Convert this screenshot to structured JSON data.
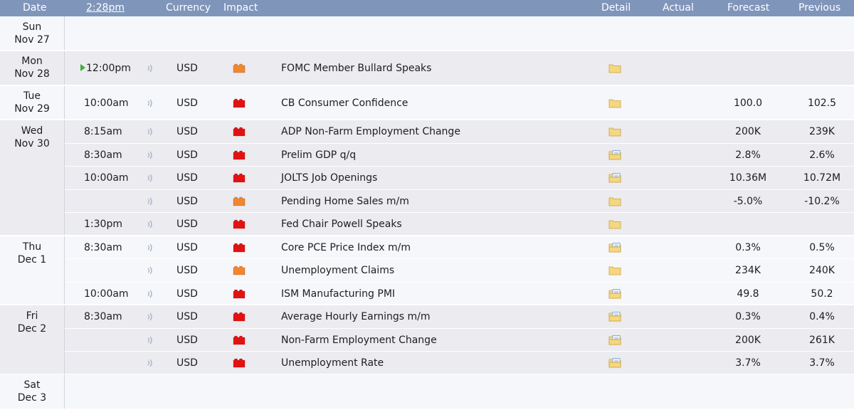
{
  "header": {
    "date": "Date",
    "time": "2:28pm",
    "currency": "Currency",
    "impact": "Impact",
    "detail": "Detail",
    "actual": "Actual",
    "forecast": "Forecast",
    "previous": "Previous"
  },
  "colors": {
    "header_bg": "#7f95ba",
    "impact_high": "#e21212",
    "impact_medium": "#f0872f",
    "live_marker": "#3fae3f",
    "folder": "#f6d780",
    "doc_blue": "#7aa2d6"
  },
  "days": [
    {
      "day": "Sun",
      "date": "Nov 27",
      "events": []
    },
    {
      "day": "Mon",
      "date": "Nov 28",
      "events": [
        {
          "time": "12:00pm",
          "live": true,
          "currency": "USD",
          "impact": "medium",
          "event": "FOMC Member Bullard Speaks",
          "detail_icon": "folder-icon",
          "actual": "",
          "forecast": "",
          "previous": ""
        }
      ]
    },
    {
      "day": "Tue",
      "date": "Nov 29",
      "events": [
        {
          "time": "10:00am",
          "currency": "USD",
          "impact": "high",
          "event": "CB Consumer Confidence",
          "detail_icon": "folder-icon",
          "actual": "",
          "forecast": "100.0",
          "previous": "102.5"
        }
      ]
    },
    {
      "day": "Wed",
      "date": "Nov 30",
      "events": [
        {
          "time": "8:15am",
          "currency": "USD",
          "impact": "high",
          "event": "ADP Non-Farm Employment Change",
          "detail_icon": "folder-icon",
          "actual": "",
          "forecast": "200K",
          "previous": "239K"
        },
        {
          "time": "8:30am",
          "currency": "USD",
          "impact": "high",
          "event": "Prelim GDP q/q",
          "detail_icon": "folder-doc-icon",
          "actual": "",
          "forecast": "2.8%",
          "previous": "2.6%"
        },
        {
          "time": "10:00am",
          "currency": "USD",
          "impact": "high",
          "event": "JOLTS Job Openings",
          "detail_icon": "folder-doc-icon",
          "actual": "",
          "forecast": "10.36M",
          "previous": "10.72M"
        },
        {
          "time": "",
          "currency": "USD",
          "impact": "medium",
          "event": "Pending Home Sales m/m",
          "detail_icon": "folder-icon",
          "actual": "",
          "forecast": "-5.0%",
          "previous": "-10.2%"
        },
        {
          "time": "1:30pm",
          "currency": "USD",
          "impact": "high",
          "event": "Fed Chair Powell Speaks",
          "detail_icon": "folder-icon",
          "actual": "",
          "forecast": "",
          "previous": ""
        }
      ]
    },
    {
      "day": "Thu",
      "date": "Dec 1",
      "events": [
        {
          "time": "8:30am",
          "currency": "USD",
          "impact": "high",
          "event": "Core PCE Price Index m/m",
          "detail_icon": "folder-doc-icon",
          "actual": "",
          "forecast": "0.3%",
          "previous": "0.5%"
        },
        {
          "time": "",
          "currency": "USD",
          "impact": "medium",
          "event": "Unemployment Claims",
          "detail_icon": "folder-icon",
          "actual": "",
          "forecast": "234K",
          "previous": "240K"
        },
        {
          "time": "10:00am",
          "currency": "USD",
          "impact": "high",
          "event": "ISM Manufacturing PMI",
          "detail_icon": "folder-doc-icon",
          "actual": "",
          "forecast": "49.8",
          "previous": "50.2"
        }
      ]
    },
    {
      "day": "Fri",
      "date": "Dec 2",
      "events": [
        {
          "time": "8:30am",
          "currency": "USD",
          "impact": "high",
          "event": "Average Hourly Earnings m/m",
          "detail_icon": "folder-doc-icon",
          "actual": "",
          "forecast": "0.3%",
          "previous": "0.4%"
        },
        {
          "time": "",
          "currency": "USD",
          "impact": "high",
          "event": "Non-Farm Employment Change",
          "detail_icon": "folder-doc-icon",
          "actual": "",
          "forecast": "200K",
          "previous": "261K"
        },
        {
          "time": "",
          "currency": "USD",
          "impact": "high",
          "event": "Unemployment Rate",
          "detail_icon": "folder-doc-icon",
          "actual": "",
          "forecast": "3.7%",
          "previous": "3.7%"
        }
      ]
    },
    {
      "day": "Sat",
      "date": "Dec 3",
      "events": []
    }
  ]
}
